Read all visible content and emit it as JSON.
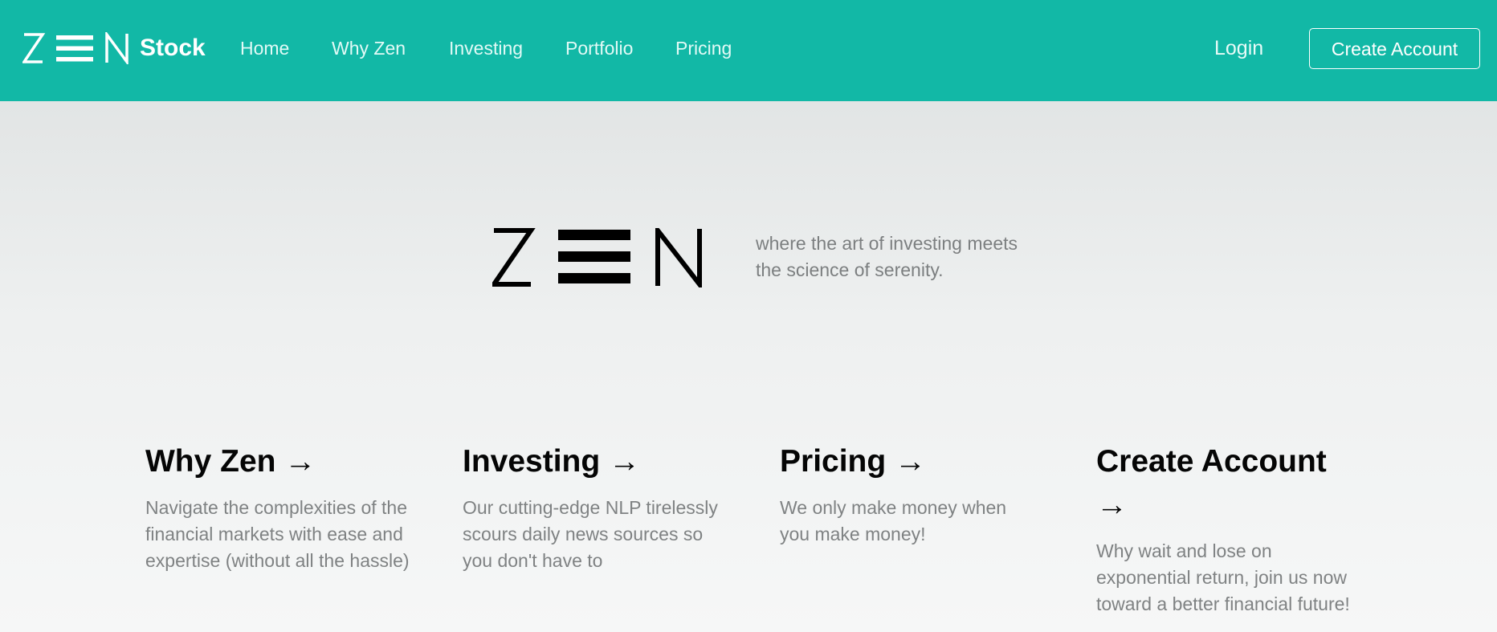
{
  "navbar": {
    "brand_name": "Stock",
    "logo_icon": "zen-logo",
    "links": [
      {
        "label": "Home"
      },
      {
        "label": "Why Zen"
      },
      {
        "label": "Investing"
      },
      {
        "label": "Portfolio"
      },
      {
        "label": "Pricing"
      }
    ],
    "login_label": "Login",
    "create_account_label": "Create Account",
    "background_color": "#12b8a6"
  },
  "hero": {
    "logo_icon": "zen-logo",
    "tagline": "where the art of investing meets the science of serenity."
  },
  "features": [
    {
      "title": "Why Zen →",
      "description": "Navigate the complexities of the financial markets with ease and expertise (without all the hassle)"
    },
    {
      "title": "Investing →",
      "description": "Our cutting-edge NLP tirelessly scours daily news sources so you don't have to"
    },
    {
      "title": "Pricing →",
      "description": "We only make money when you make money!"
    },
    {
      "title": "Create Account →",
      "description": "Why wait and lose on exponential return, join us now toward a better financial future!"
    }
  ]
}
